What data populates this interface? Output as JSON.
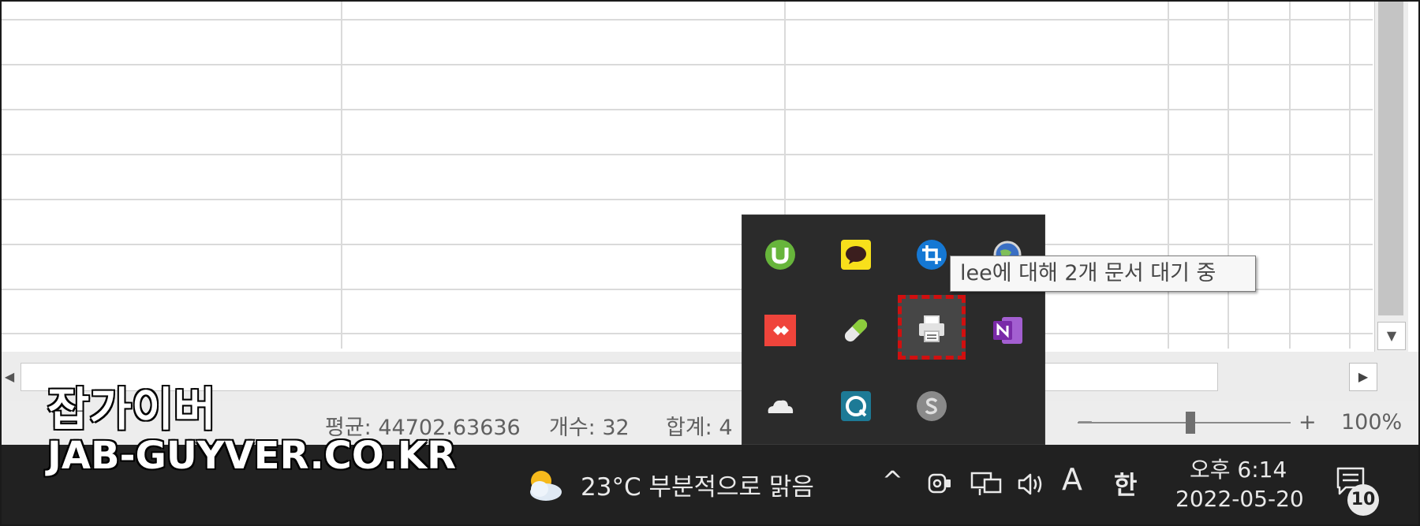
{
  "status_bar": {
    "average": "평균: 44702.63636",
    "count": "개수: 32",
    "sum": "합계: 4",
    "zoom_minus": "−",
    "zoom_plus": "+",
    "zoom_level": "100%",
    "zoom_fraction": 0.53
  },
  "tooltip": "lee에 대해 2개 문서 대기 중",
  "tray_popup": {
    "icons": [
      "utorrent-icon",
      "kakaotalk-icon",
      "snip-tool-icon",
      "globe-icon",
      "anydesk-icon",
      "pill-icon",
      "printer-icon",
      "onenote-icon",
      "onedrive-icon",
      "cloud-sync-icon",
      "skype-icon"
    ]
  },
  "taskbar": {
    "weather": "23°C  부분적으로 맑음",
    "tray_arrow": "^",
    "ime_mode": "A",
    "ime_lang": "한",
    "time": "오후 6:14",
    "date": "2022-05-20",
    "notification_count": "10"
  },
  "watermark": {
    "line1": "잡가이버",
    "line2": "JAB-GUYVER.CO.KR"
  },
  "colors": {
    "taskbar_bg": "#212121",
    "popup_bg": "#2b2b2b",
    "highlight": "#d10f0f"
  }
}
